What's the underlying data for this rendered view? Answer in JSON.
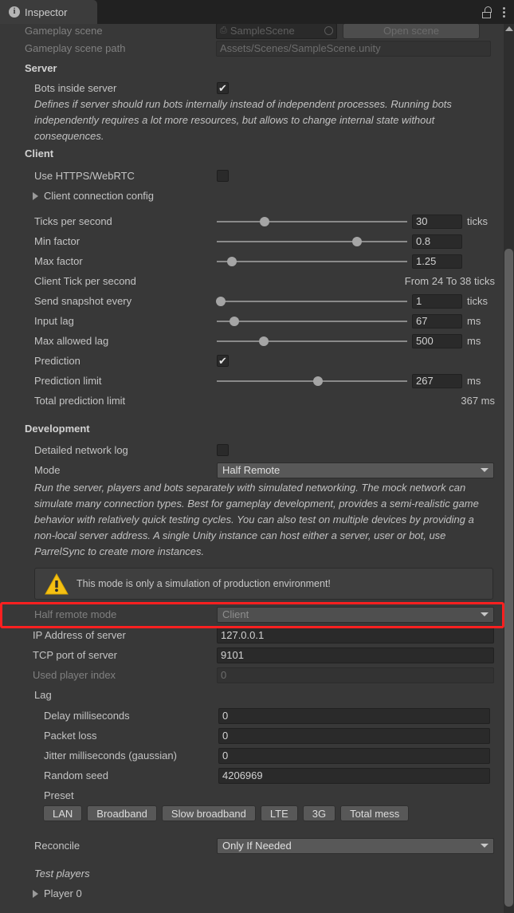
{
  "window": {
    "tab_label": "Inspector",
    "info_icon": "info-icon",
    "lock_icon": "lock-icon",
    "menu_icon": "kebab-menu-icon"
  },
  "top_partial": {
    "gameplay_scene_label": "Gameplay scene",
    "gameplay_scene_value": "SampleScene",
    "open_scene_button": "Open scene",
    "gameplay_scene_path_label": "Gameplay scene path",
    "gameplay_scene_path_value": "Assets/Scenes/SampleScene.unity"
  },
  "server": {
    "header": "Server",
    "bots_inside_server_label": "Bots inside server",
    "bots_inside_server_checked": "✔",
    "description": "Defines if server should run bots internally instead of independent processes. Running bots independently requires a lot more resources, but allows to change internal state without consequences."
  },
  "client": {
    "header": "Client",
    "use_https_label": "Use HTTPS/WebRTC",
    "use_https_checked": "",
    "connection_config_label": "Client connection config",
    "sliders": [
      {
        "label": "Ticks per second",
        "value": "30",
        "unit": "ticks",
        "pct": 25
      },
      {
        "label": "Min factor",
        "value": "0.8",
        "unit": "",
        "pct": 73.5
      },
      {
        "label": "Max factor",
        "value": "1.25",
        "unit": "",
        "pct": 8
      }
    ],
    "client_tick_label": "Client Tick per second",
    "client_tick_value": "From 24 To 38 ticks",
    "sliders2": [
      {
        "label": "Send snapshot every",
        "value": "1",
        "unit": "ticks",
        "pct": 2
      },
      {
        "label": "Input lag",
        "value": "67",
        "unit": "ms",
        "pct": 9
      },
      {
        "label": "Max allowed lag",
        "value": "500",
        "unit": "ms",
        "pct": 24.5
      }
    ],
    "prediction_label": "Prediction",
    "prediction_checked": "✔",
    "prediction_limit": {
      "label": "Prediction limit",
      "value": "267",
      "unit": "ms",
      "pct": 53
    },
    "total_prediction_label": "Total prediction limit",
    "total_prediction_value": "367 ms"
  },
  "development": {
    "header": "Development",
    "detailed_log_label": "Detailed network log",
    "detailed_log_checked": "",
    "mode_label": "Mode",
    "mode_value": "Half Remote",
    "mode_description": "Run the server, players and bots separately with simulated networking. The mock network can simulate many connection types. Best for gameplay development, provides a semi-realistic game behavior with relatively quick testing cycles. You can also test on multiple devices by providing a non-local server address. A single Unity instance can host either a server, user or bot, use ParrelSync to create more instances.",
    "warning_text": "This mode is only a simulation of production environment!",
    "warning_icon": "warning-triangle-icon",
    "half_remote_mode_label": "Half remote mode",
    "half_remote_mode_value": "Client",
    "highlight_color": "#fc2020",
    "ip_label": "IP Address of server",
    "ip_value": "127.0.0.1",
    "tcp_label": "TCP port of server",
    "tcp_value": "9101",
    "player_index_label": "Used player index",
    "player_index_value": "0",
    "lag_header": "Lag",
    "lag_fields": [
      {
        "label": "Delay milliseconds",
        "value": "0"
      },
      {
        "label": "Packet loss",
        "value": "0"
      },
      {
        "label": "Jitter milliseconds (gaussian)",
        "value": "0"
      },
      {
        "label": "Random seed",
        "value": "4206969"
      }
    ],
    "preset_label": "Preset",
    "presets": [
      "LAN",
      "Broadband",
      "Slow broadband",
      "LTE",
      "3G",
      "Total mess"
    ],
    "reconcile_label": "Reconcile",
    "reconcile_value": "Only If Needed",
    "test_players_label": "Test players",
    "player_0_label": "Player 0"
  }
}
